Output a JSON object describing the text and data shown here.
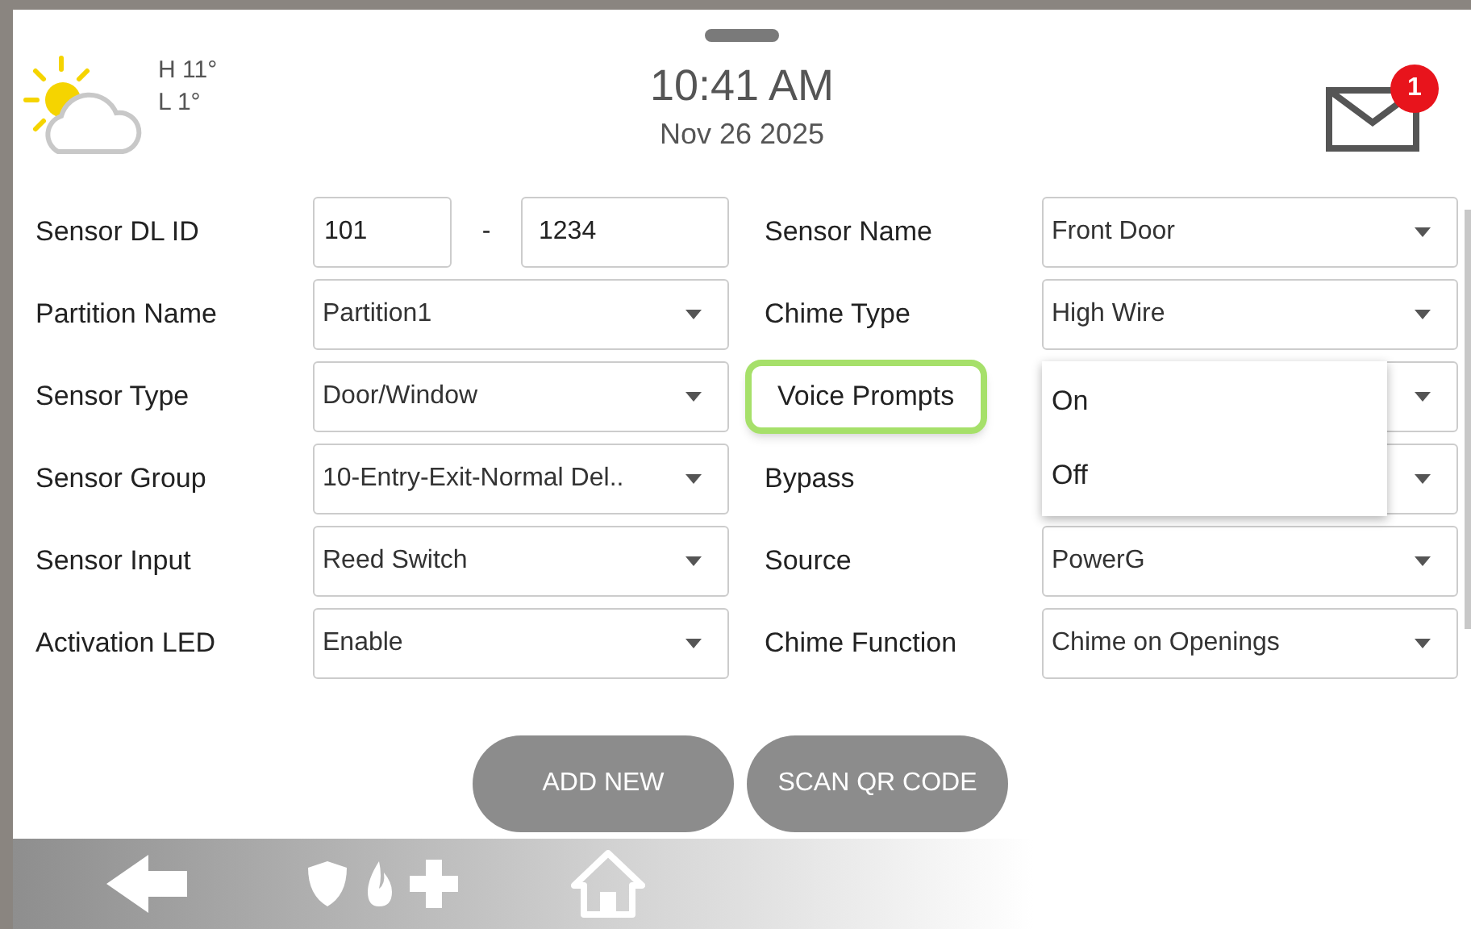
{
  "header": {
    "weather": {
      "high": "H 11°",
      "low": "L 1°"
    },
    "time": "10:41 AM",
    "date": "Nov 26 2025",
    "messages_badge": "1"
  },
  "form": {
    "rows": [
      {
        "left": {
          "label": "Sensor DL ID",
          "kind": "pair",
          "values": [
            "101",
            "1234"
          ],
          "separator": "-"
        },
        "right": {
          "label": "Sensor Name",
          "kind": "dropdown",
          "value": "Front Door"
        }
      },
      {
        "left": {
          "label": "Partition Name",
          "kind": "dropdown",
          "value": "Partition1"
        },
        "right": {
          "label": "Chime Type",
          "kind": "dropdown",
          "value": "High Wire"
        }
      },
      {
        "left": {
          "label": "Sensor Type",
          "kind": "dropdown",
          "value": "Door/Window"
        },
        "right": {
          "label": "Voice Prompts",
          "kind": "dropdown",
          "focused": true,
          "open": true,
          "options": [
            "On",
            "Off"
          ]
        }
      },
      {
        "left": {
          "label": "Sensor Group",
          "kind": "dropdown",
          "value": "10-Entry-Exit-Normal Del.."
        },
        "right": {
          "label": "Bypass",
          "kind": "dropdown"
        }
      },
      {
        "left": {
          "label": "Sensor Input",
          "kind": "dropdown",
          "value": "Reed Switch"
        },
        "right": {
          "label": "Source",
          "kind": "dropdown",
          "value": "PowerG"
        }
      },
      {
        "left": {
          "label": "Activation LED",
          "kind": "dropdown",
          "value": "Enable"
        },
        "right": {
          "label": "Chime Function",
          "kind": "dropdown",
          "value": "Chime on Openings"
        }
      }
    ]
  },
  "buttons": [
    "ADD NEW",
    "SCAN QR CODE"
  ]
}
